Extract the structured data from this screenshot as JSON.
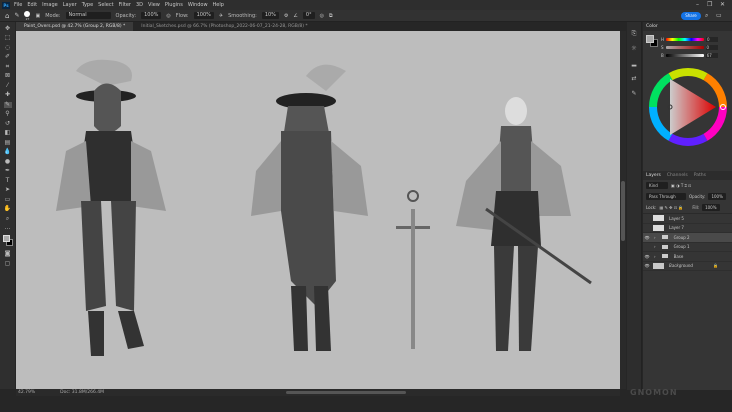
{
  "app": {
    "logo": "Ps",
    "menu": [
      "File",
      "Edit",
      "Image",
      "Layer",
      "Type",
      "Select",
      "Filter",
      "3D",
      "View",
      "Plugins",
      "Window",
      "Help"
    ]
  },
  "options": {
    "brush_size": "27",
    "mode_label": "Mode:",
    "mode": "Normal",
    "opacity_label": "Opacity:",
    "opacity": "100%",
    "flow_label": "Flow:",
    "flow": "100%",
    "smoothing_label": "Smoothing:",
    "smoothing": "10%",
    "angle": "0°",
    "share": "Share"
  },
  "tabs": [
    {
      "label": "Paint_Overs.psd @ 42.7% (Group 2, RGB/8) *",
      "active": true
    },
    {
      "label": "Initial_Sketches.psd @ 66.7% (Photoshop_2022-06-07_21-24-28, RGB/8) *",
      "active": false
    }
  ],
  "status": {
    "zoom": "42.79%",
    "doc": "Doc: 31.8M/266.4M"
  },
  "color_panel": {
    "title": "Color",
    "h_label": "H",
    "h": "0",
    "s_label": "S",
    "s": "0",
    "b_label": "B",
    "b": "67",
    "foreground": "#aaaaaa",
    "background": "#000000"
  },
  "layers_panel": {
    "tabs": [
      "Layers",
      "Channels",
      "Paths"
    ],
    "filter": "Kind",
    "blend": "Pass Through",
    "opacity_label": "Opacity:",
    "opacity": "100%",
    "lock_label": "Lock:",
    "fill_label": "Fill:",
    "fill": "100%",
    "layers": [
      {
        "name": "Layer 5",
        "visible": false,
        "type": "pixel"
      },
      {
        "name": "Layer 7",
        "visible": false,
        "type": "pixel"
      },
      {
        "name": "Group 2",
        "visible": true,
        "type": "group",
        "selected": true
      },
      {
        "name": "Group 1",
        "visible": false,
        "type": "group"
      },
      {
        "name": "Base",
        "visible": true,
        "type": "group"
      },
      {
        "name": "Background",
        "visible": true,
        "type": "pixel",
        "locked": true
      }
    ]
  },
  "watermark": "GNOMON WORKSHOP"
}
